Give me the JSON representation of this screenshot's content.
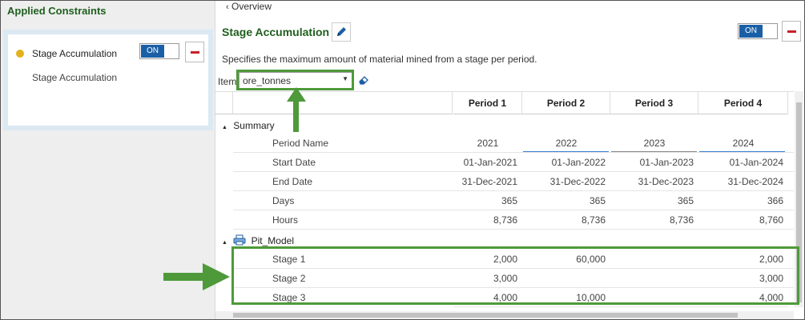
{
  "left_panel": {
    "title": "Applied Constraints",
    "constraint": {
      "name": "Stage Accumulation",
      "subtitle": "Stage Accumulation",
      "toggle_label": "ON",
      "status_color": "#e3b21a"
    }
  },
  "main": {
    "back_label": "Overview",
    "title": "Stage Accumulation",
    "toggle_label": "ON",
    "description": "Specifies the maximum amount of material mined from a stage per period.",
    "item_label": "Item",
    "item_value": "ore_tonnes"
  },
  "grid": {
    "columns": [
      "Period 1",
      "Period 2",
      "Period 3",
      "Period 4"
    ],
    "summary": {
      "group_label": "Summary",
      "rows": [
        {
          "label": "Period Name",
          "values": [
            "2021",
            "2022",
            "2023",
            "2024"
          ]
        },
        {
          "label": "Start Date",
          "values": [
            "01-Jan-2021",
            "01-Jan-2022",
            "01-Jan-2023",
            "01-Jan-2024"
          ]
        },
        {
          "label": "End Date",
          "values": [
            "31-Dec-2021",
            "31-Dec-2022",
            "31-Dec-2023",
            "31-Dec-2024"
          ]
        },
        {
          "label": "Days",
          "values": [
            "365",
            "365",
            "365",
            "366"
          ]
        },
        {
          "label": "Hours",
          "values": [
            "8,736",
            "8,736",
            "8,736",
            "8,760"
          ]
        }
      ]
    },
    "pit": {
      "group_label": "Pit_Model",
      "rows": [
        {
          "label": "Stage 1",
          "values": [
            "2,000",
            "60,000",
            "",
            "2,000"
          ]
        },
        {
          "label": "Stage 2",
          "values": [
            "3,000",
            "",
            "",
            "3,000"
          ]
        },
        {
          "label": "Stage 3",
          "values": [
            "4,000",
            "10,000",
            "",
            "4,000"
          ]
        }
      ]
    }
  },
  "colors": {
    "title_green": "#1e5f1e",
    "highlight_green": "#4e9a3a",
    "toggle_blue": "#1a5fa6",
    "minus_red": "#c8202a"
  }
}
